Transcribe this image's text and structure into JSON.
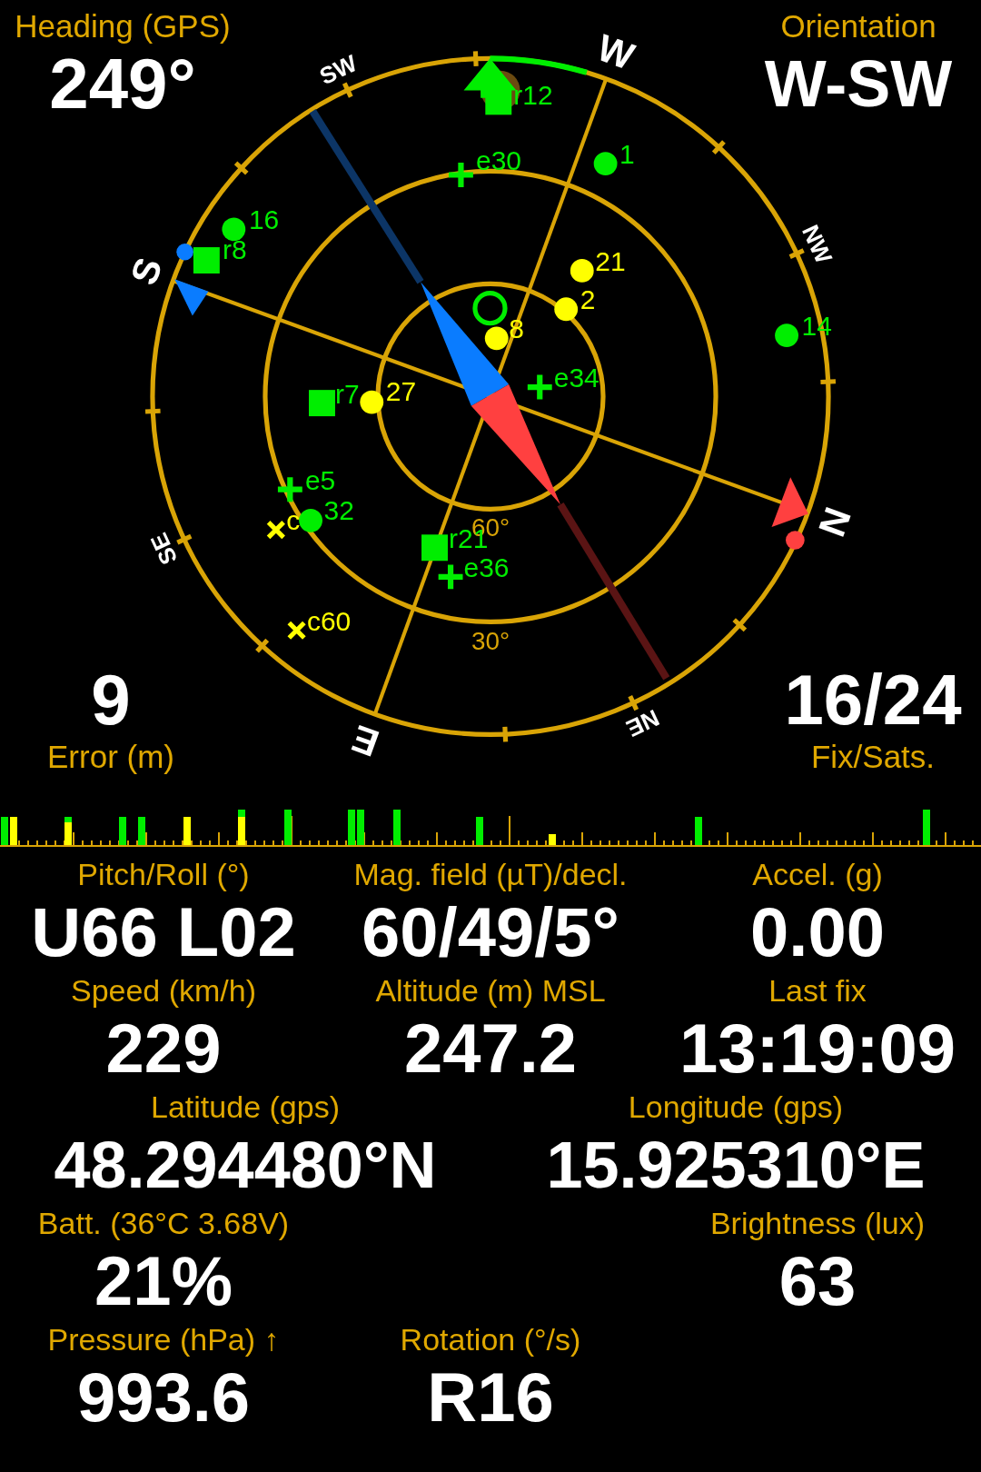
{
  "heading": {
    "label": "Heading (GPS)",
    "value": "249°"
  },
  "orientation": {
    "label": "Orientation",
    "value": "W-SW"
  },
  "error": {
    "value": "9",
    "label": "Error (m)"
  },
  "fix": {
    "value": "16/24",
    "label": "Fix/Sats."
  },
  "sky_plot": {
    "cardinals": [
      {
        "label": "N",
        "kind": "major"
      },
      {
        "label": "NE",
        "kind": "minor"
      },
      {
        "label": "E",
        "kind": "major"
      },
      {
        "label": "SE",
        "kind": "minor"
      },
      {
        "label": "S",
        "kind": "major"
      },
      {
        "label": "SW",
        "kind": "minor"
      },
      {
        "label": "W",
        "kind": "major"
      },
      {
        "label": "NW",
        "kind": "minor"
      }
    ],
    "elevation_labels": [
      "60°",
      "30°"
    ],
    "satellites": [
      {
        "label": "r12",
        "kind": "square",
        "color": "#00ee00"
      },
      {
        "label": "1",
        "kind": "circle",
        "color": "#00ee00"
      },
      {
        "label": "e30",
        "kind": "plus",
        "color": "#00ee00"
      },
      {
        "label": "16",
        "kind": "circle",
        "color": "#00ee00"
      },
      {
        "label": "r8",
        "kind": "square",
        "color": "#00ee00"
      },
      {
        "label": "21",
        "kind": "circle",
        "color": "#ffff00"
      },
      {
        "label": "2",
        "kind": "circle",
        "color": "#ffff00"
      },
      {
        "label": "8",
        "kind": "circle",
        "color": "#ffff00"
      },
      {
        "label": "14",
        "kind": "circle",
        "color": "#00ee00"
      },
      {
        "label": "e34",
        "kind": "plus",
        "color": "#00ee00"
      },
      {
        "label": "r7",
        "kind": "square",
        "color": "#00ee00"
      },
      {
        "label": "27",
        "kind": "circle",
        "color": "#ffff00"
      },
      {
        "label": "e5",
        "kind": "plus",
        "color": "#00ee00"
      },
      {
        "label": "c",
        "kind": "cross",
        "color": "#ffff00"
      },
      {
        "label": "32",
        "kind": "circle",
        "color": "#00ee00"
      },
      {
        "label": "r21",
        "kind": "square",
        "color": "#00ee00"
      },
      {
        "label": "e36",
        "kind": "plus",
        "color": "#00ee00"
      },
      {
        "label": "c60",
        "kind": "cross",
        "color": "#ffff00"
      }
    ]
  },
  "readings": [
    {
      "cells": [
        {
          "label": "Pitch/Roll (°)",
          "value": "U66 L02"
        },
        {
          "label": "Mag. field (µT)/decl.",
          "value": "60/49/5°"
        },
        {
          "label": "Accel. (g)",
          "value": "0.00"
        }
      ]
    },
    {
      "cells": [
        {
          "label": "Speed (km/h)",
          "value": "229"
        },
        {
          "label": "Altitude (m) MSL",
          "value": "247.2"
        },
        {
          "label": "Last fix",
          "value": "13:19:09"
        }
      ]
    },
    {
      "cells": [
        {
          "label": "Latitude (gps)",
          "value": "48.294480°N"
        },
        {
          "label": "Longitude (gps)",
          "value": "15.925310°E"
        }
      ]
    },
    {
      "cells": [
        {
          "label": "Batt. (36°C 3.68V)",
          "value": "21%"
        },
        {
          "label": "Brightness (lux)",
          "value": "63"
        }
      ]
    },
    {
      "cells": [
        {
          "label": "Pressure (hPa) ↑",
          "value": "993.6"
        },
        {
          "label": "Rotation (°/s)",
          "value": "R16"
        }
      ]
    }
  ]
}
